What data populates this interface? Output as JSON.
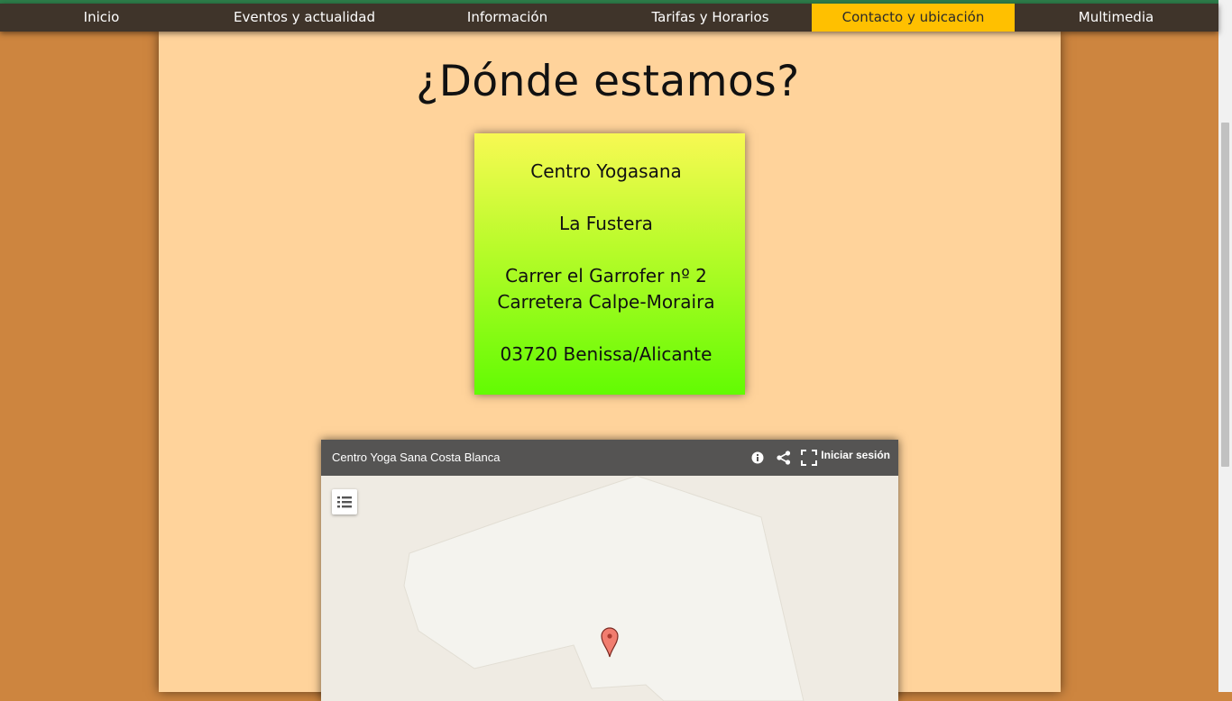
{
  "nav": {
    "items": [
      {
        "label": "Inicio"
      },
      {
        "label": "Eventos y actualidad"
      },
      {
        "label": "Información"
      },
      {
        "label": "Tarifas y Horarios"
      },
      {
        "label": "Contacto y ubicación",
        "active": true
      },
      {
        "label": "Multimedia"
      }
    ]
  },
  "page": {
    "title": "¿Dónde estamos?"
  },
  "address": {
    "name": "Centro Yogasana",
    "area": "La Fustera",
    "street": "Carrer el Garrofer nº 2",
    "road": "Carretera Calpe-Moraira",
    "city": "03720 Benissa/Alicante"
  },
  "map": {
    "title": "Centro Yoga Sana Costa Blanca",
    "signin_label": "Iniciar sesión",
    "icons": [
      "info-icon",
      "share-icon",
      "fullscreen-icon",
      "legend-list-icon",
      "map-pin-icon"
    ]
  },
  "colors": {
    "nav_bg": "#3f342a",
    "nav_active": "#ffc000",
    "page_bg": "#cd853f",
    "content_bg": "#ffd39b",
    "pin": "#f17d6f"
  }
}
